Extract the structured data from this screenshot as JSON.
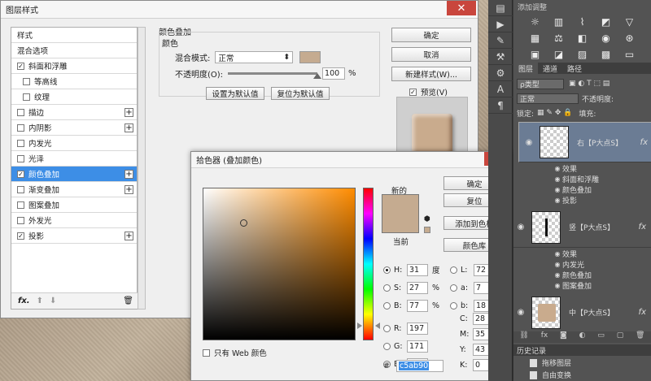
{
  "layer_style": {
    "title": "图层样式",
    "sidebar": [
      {
        "label": "样式",
        "checkbox": false,
        "checked": false,
        "plus": false,
        "indent": false,
        "selected": false
      },
      {
        "label": "混合选项",
        "checkbox": false,
        "checked": false,
        "plus": false,
        "indent": false,
        "selected": false
      },
      {
        "label": "斜面和浮雕",
        "checkbox": true,
        "checked": true,
        "plus": false,
        "indent": false,
        "selected": false
      },
      {
        "label": "等高线",
        "checkbox": true,
        "checked": false,
        "plus": false,
        "indent": true,
        "selected": false
      },
      {
        "label": "纹理",
        "checkbox": true,
        "checked": false,
        "plus": false,
        "indent": true,
        "selected": false
      },
      {
        "label": "描边",
        "checkbox": true,
        "checked": false,
        "plus": true,
        "indent": false,
        "selected": false
      },
      {
        "label": "内阴影",
        "checkbox": true,
        "checked": false,
        "plus": true,
        "indent": false,
        "selected": false
      },
      {
        "label": "内发光",
        "checkbox": true,
        "checked": false,
        "plus": false,
        "indent": false,
        "selected": false
      },
      {
        "label": "光泽",
        "checkbox": true,
        "checked": false,
        "plus": false,
        "indent": false,
        "selected": false
      },
      {
        "label": "颜色叠加",
        "checkbox": true,
        "checked": true,
        "plus": true,
        "indent": false,
        "selected": true
      },
      {
        "label": "渐变叠加",
        "checkbox": true,
        "checked": false,
        "plus": true,
        "indent": false,
        "selected": false
      },
      {
        "label": "图案叠加",
        "checkbox": true,
        "checked": false,
        "plus": false,
        "indent": false,
        "selected": false
      },
      {
        "label": "外发光",
        "checkbox": true,
        "checked": false,
        "plus": false,
        "indent": false,
        "selected": false
      },
      {
        "label": "投影",
        "checkbox": true,
        "checked": true,
        "plus": true,
        "indent": false,
        "selected": false
      }
    ],
    "footer_fx": "fx.",
    "overlay": {
      "group_title": "颜色叠加",
      "sub_title": "颜色",
      "blend_label": "混合模式:",
      "blend_value": "正常",
      "opacity_label": "不透明度(O):",
      "opacity_value": "100",
      "opacity_fraction": 1.0,
      "opacity_unit": "%",
      "color": "#c5ab90",
      "set_default": "设置为默认值",
      "reset_default": "复位为默认值"
    },
    "buttons": {
      "ok": "确定",
      "cancel": "取消",
      "new_style": "新建样式(W)...",
      "preview_label": "预览(V)"
    }
  },
  "color_picker": {
    "title": "拾色器 (叠加颜色)",
    "new_label": "新的",
    "current_label": "当前",
    "new_color": "#c5ab90",
    "current_color": "#c5ab90",
    "hue_color": "#ff8c00",
    "buttons": {
      "ok": "确定",
      "reset": "复位",
      "add_swatch": "添加到色板",
      "library": "颜色库"
    },
    "web_only": "只有 Web 颜色",
    "hsb": [
      {
        "label": "H:",
        "value": "31",
        "unit": "度",
        "selected": true
      },
      {
        "label": "S:",
        "value": "27",
        "unit": "%",
        "selected": false
      },
      {
        "label": "B:",
        "value": "77",
        "unit": "%",
        "selected": false
      }
    ],
    "rgb": [
      {
        "label": "R:",
        "value": "197"
      },
      {
        "label": "G:",
        "value": "171"
      },
      {
        "label": "B:",
        "value": "144"
      }
    ],
    "lab": [
      {
        "label": "L:",
        "value": "72"
      },
      {
        "label": "a:",
        "value": "7"
      },
      {
        "label": "b:",
        "value": "18"
      }
    ],
    "cmyk": [
      {
        "label": "C:",
        "value": "28",
        "unit": "%"
      },
      {
        "label": "M:",
        "value": "35",
        "unit": "%"
      },
      {
        "label": "Y:",
        "value": "43",
        "unit": "%"
      },
      {
        "label": "K:",
        "value": "0",
        "unit": "%"
      }
    ],
    "hex_label": "#",
    "hex_value": "c5ab90"
  },
  "ps_panel": {
    "adjust_title": "添加调整",
    "tabs": [
      "图层",
      "通道",
      "路径"
    ],
    "filter_label": "ρ类型",
    "blend_mode": "正常",
    "opacity_label": "不透明度:",
    "lock_label": "锁定:",
    "fill_label": "填充:",
    "layers": [
      {
        "name": "右【P大点S】",
        "fx": "fx",
        "selected": true,
        "effects_label": "效果",
        "effects": [
          "斜面和浮雕",
          "颜色叠加",
          "投影"
        ]
      },
      {
        "name": "竖【P大点S】",
        "fx": "fx",
        "selected": false,
        "effects_label": "效果",
        "effects": [
          "内发光",
          "颜色叠加",
          "图案叠加"
        ]
      },
      {
        "name": "中【P大点S】",
        "fx": "fx",
        "selected": false,
        "effects_label": "效果",
        "effects": []
      }
    ],
    "history_title": "历史记录",
    "history": [
      "拖移图层",
      "自由变换"
    ]
  }
}
